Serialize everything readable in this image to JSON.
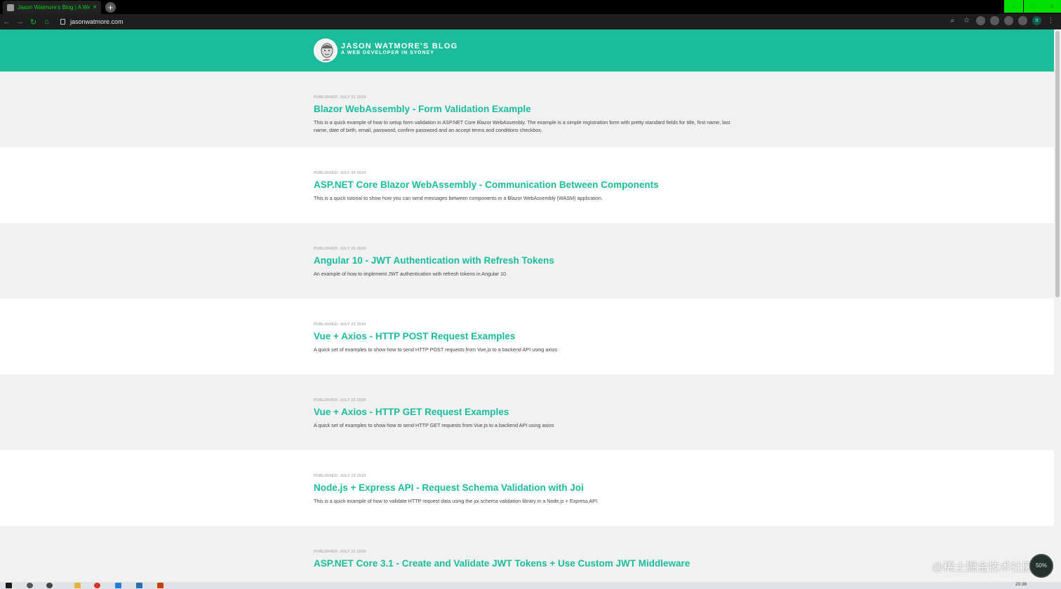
{
  "browser": {
    "tab_title": "Jason Watmore's Blog | A We",
    "url": "jasonwatmore.com",
    "new_tab_label": "+",
    "close_tab_label": "×",
    "profile_initial": "tt"
  },
  "site": {
    "title": "JASON WATMORE'S BLOG",
    "subtitle": "A WEB DEVELOPER IN SYDNEY",
    "accent": "#1abc9c"
  },
  "posts": [
    {
      "date": "PUBLISHED: JULY 31 2020",
      "title": "Blazor WebAssembly - Form Validation Example",
      "summary": "This is a quick example of how to setup form validation in ASP.NET Core Blazor WebAssembly. The example is a simple registration form with pretty standard fields for title, first name, last name, date of birth, email, password, confirm password and an accept terms and conditions checkbox."
    },
    {
      "date": "PUBLISHED: JULY 30 2020",
      "title": "ASP.NET Core Blazor WebAssembly - Communication Between Components",
      "summary": "This is a quick tutorial to show how you can send messages between components in a Blazor WebAssembly (WASM) application."
    },
    {
      "date": "PUBLISHED: JULY 25 2020",
      "title": "Angular 10 - JWT Authentication with Refresh Tokens",
      "summary": "An example of how to implement JWT authentication with refresh tokens in Angular 10."
    },
    {
      "date": "PUBLISHED: JULY 23 2020",
      "title": "Vue + Axios - HTTP POST Request Examples",
      "summary": "A quick set of examples to show how to send HTTP POST requests from Vue.js to a backend API using axios"
    },
    {
      "date": "PUBLISHED: JULY 23 2020",
      "title": "Vue + Axios - HTTP GET Request Examples",
      "summary": "A quick set of examples to show how to send HTTP GET requests from Vue.js to a backend API using axios"
    },
    {
      "date": "PUBLISHED: JULY 22 2020",
      "title": "Node.js + Express API - Request Schema Validation with Joi",
      "summary": "This is a quick example of how to validate HTTP request data using the joi schema validation library in a Node.js + Express API."
    },
    {
      "date": "PUBLISHED: JULY 21 2020",
      "title": "ASP.NET Core 3.1 - Create and Validate JWT Tokens + Use Custom JWT Middleware",
      "summary": ""
    }
  ],
  "taskbar": {
    "clock": "20:36"
  },
  "overlay": {
    "watermark": "@稀土掘金技术社区",
    "zoom": "50%"
  }
}
